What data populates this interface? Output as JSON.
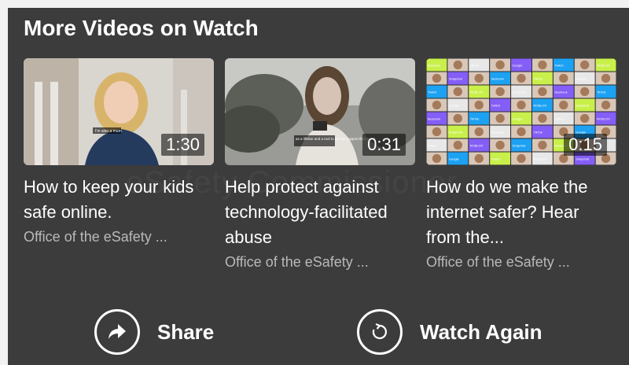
{
  "section_title": "More Videos on Watch",
  "watermark_text": "eSafety Commissioner",
  "videos": [
    {
      "title": "How to keep your kids safe online.",
      "channel": "Office of the eSafety ...",
      "duration": "1:30",
      "caption": "I'm also a mum"
    },
    {
      "title": "Help protect against technology-facilitated abuse",
      "channel": "Office of the eSafety ...",
      "duration": "0:31",
      "caption": "as a lifeline and a tool to get the support they need"
    },
    {
      "title": "How do we make the internet safer? Hear from the...",
      "channel": "Office of the eSafety ...",
      "duration": "0:15",
      "logos": [
        "facebook",
        "TikTok",
        "Google",
        "Twitch",
        "ROBLOX",
        "Snapchat"
      ]
    }
  ],
  "actions": {
    "share_label": "Share",
    "watch_again_label": "Watch Again"
  },
  "icons": {
    "share": "share-arrow-icon",
    "watch_again": "replay-icon"
  },
  "colors": {
    "panel_bg": "#3c3c3c",
    "text_primary": "#ffffff",
    "text_secondary": "#b9b9b9"
  }
}
